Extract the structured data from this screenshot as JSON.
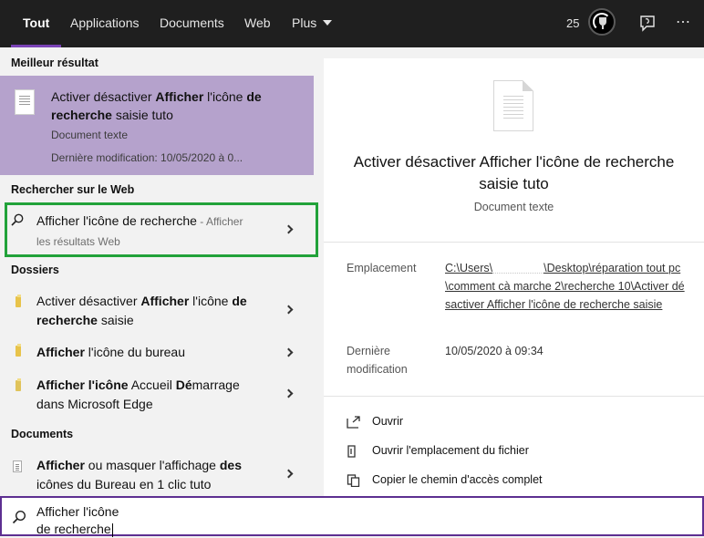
{
  "topbar": {
    "tabs": [
      {
        "label": "Tout",
        "active": true
      },
      {
        "label": "Applications"
      },
      {
        "label": "Documents"
      },
      {
        "label": "Web"
      },
      {
        "label": "Plus"
      }
    ],
    "points": "25",
    "icons": [
      "rewards-icon",
      "feedback-icon",
      "more-options-icon"
    ],
    "more_glyph": "⋯"
  },
  "left": {
    "best_header": "Meilleur résultat",
    "best": {
      "title_pre": "Activer désactiver ",
      "title_bold": "Afficher",
      "title_mid": " l'icône ",
      "title_bold2": "de recherche",
      "title_post": " saisie tuto",
      "type": "Document texte",
      "date": "Dernière modification: 10/05/2020 à 0..."
    },
    "web_header": "Rechercher sur le Web",
    "web": {
      "query": "Afficher l'icône de recherche",
      "suffix": " - Afficher",
      "suffix2": "les résultats Web"
    },
    "folders_header": "Dossiers",
    "folders": [
      {
        "pre": "Activer désactiver ",
        "bold": "Afficher",
        "mid": " l'icône ",
        "bold2": "de",
        "line2_bold": "recherche",
        "line2": " saisie"
      },
      {
        "bold": "Afficher",
        "post": " l'icône du bureau"
      },
      {
        "bold": "Afficher l'icône",
        "post": " Accueil ",
        "bold2": "Dé",
        "post2": "marrage",
        "line2": "dans Microsoft Edge"
      }
    ],
    "documents_header": "Documents",
    "documents": [
      {
        "bold": "Afficher",
        "post": " ou masquer l'affichage ",
        "bold2": "des",
        "line2_pre": "icônes du Bureau en 1 clic tuto"
      }
    ]
  },
  "right": {
    "title": "Activer désactiver Afficher l'icône de recherche saisie tuto",
    "type": "Document texte",
    "location_label": "Emplacement",
    "location_line1_a": "C:\\Users\\",
    "location_line1_b": "\\Desktop\\réparation tout",
    "location_rest": "pc\\comment cà marche 2\\recherche 10\\Activer désactiver Afficher l'icône de recherche saisie",
    "modified_label": "Dernière modification",
    "modified_value": "10/05/2020 à 09:34",
    "actions": [
      {
        "icon": "open-icon",
        "label": "Ouvrir"
      },
      {
        "icon": "folder-location-icon",
        "label": "Ouvrir l'emplacement du fichier"
      },
      {
        "icon": "copy-path-icon",
        "label": "Copier le chemin d'accès complet"
      }
    ]
  },
  "search": {
    "line1": "Afficher l'icône",
    "line2": "de recherche"
  },
  "colors": {
    "topbar": "#1f1f1f",
    "accent": "#7a43b6",
    "best_result_bg": "#b5a2cc",
    "highlight_box": "#22a23a"
  }
}
